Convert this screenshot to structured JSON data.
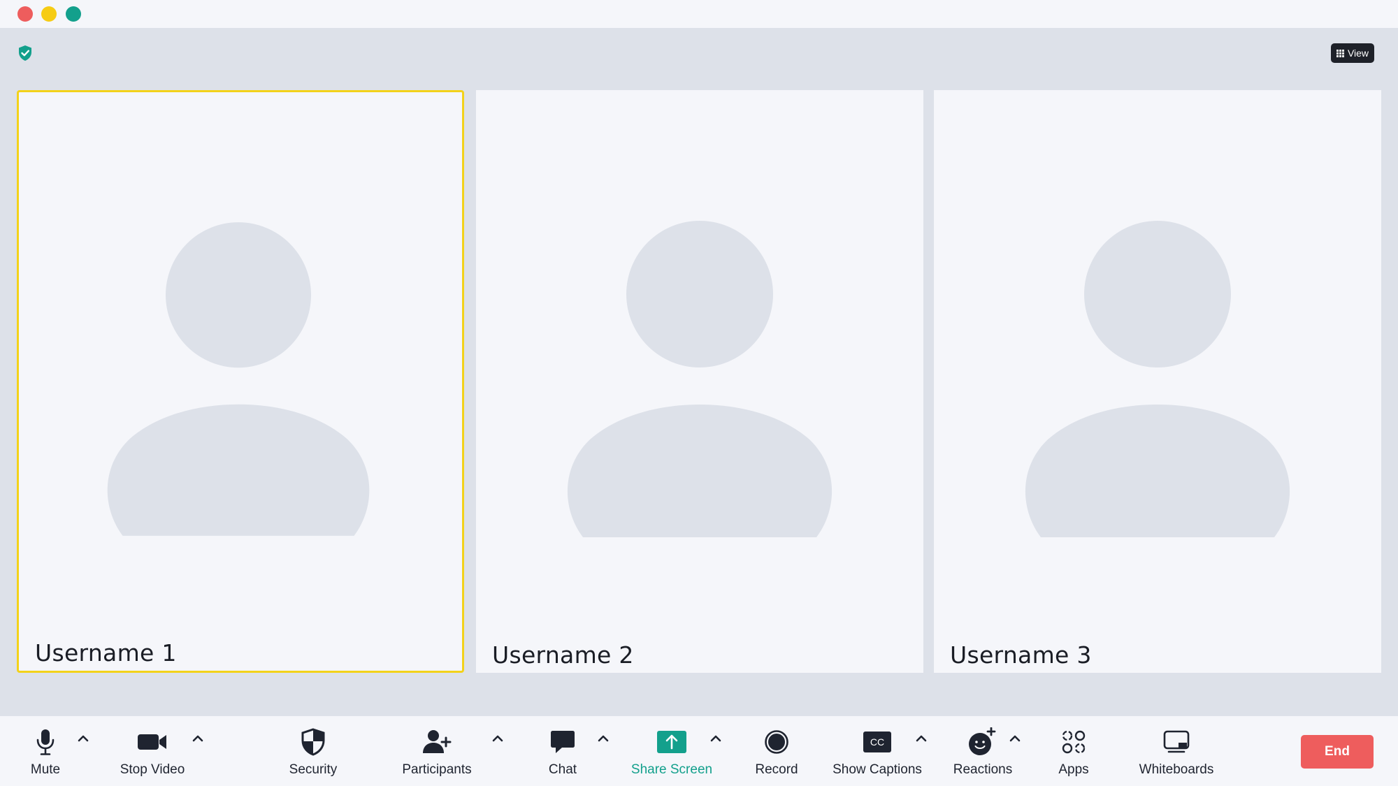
{
  "window": {
    "controls": [
      "close",
      "minimize",
      "maximize"
    ]
  },
  "header": {
    "view_label": "View"
  },
  "participants": [
    {
      "name": "Username 1",
      "active_speaker": true
    },
    {
      "name": "Username 2",
      "active_speaker": false
    },
    {
      "name": "Username 3",
      "active_speaker": false
    }
  ],
  "toolbar": {
    "mute_label": "Mute",
    "stop_video_label": "Stop Video",
    "security_label": "Security",
    "participants_label": "Participants",
    "chat_label": "Chat",
    "share_screen_label": "Share Screen",
    "record_label": "Record",
    "show_captions_label": "Show Captions",
    "reactions_label": "Reactions",
    "apps_label": "Apps",
    "whiteboards_label": "Whiteboards",
    "end_label": "End",
    "captions_icon_text": "CC"
  },
  "colors": {
    "accent": "#13a08c",
    "active_speaker_border": "#f3d21a",
    "end_button": "#ee5d5d",
    "background": "#dde1e9",
    "tile": "#f5f6fa",
    "avatar": "#dde1e9"
  },
  "icons": {
    "status": "shield-check-icon",
    "toolbar": [
      "microphone-icon",
      "video-camera-icon",
      "shield-icon",
      "add-user-icon",
      "chat-bubble-icon",
      "share-screen-icon",
      "record-icon",
      "closed-captions-icon",
      "reaction-smiley-icon",
      "apps-icon",
      "whiteboard-icon"
    ]
  }
}
